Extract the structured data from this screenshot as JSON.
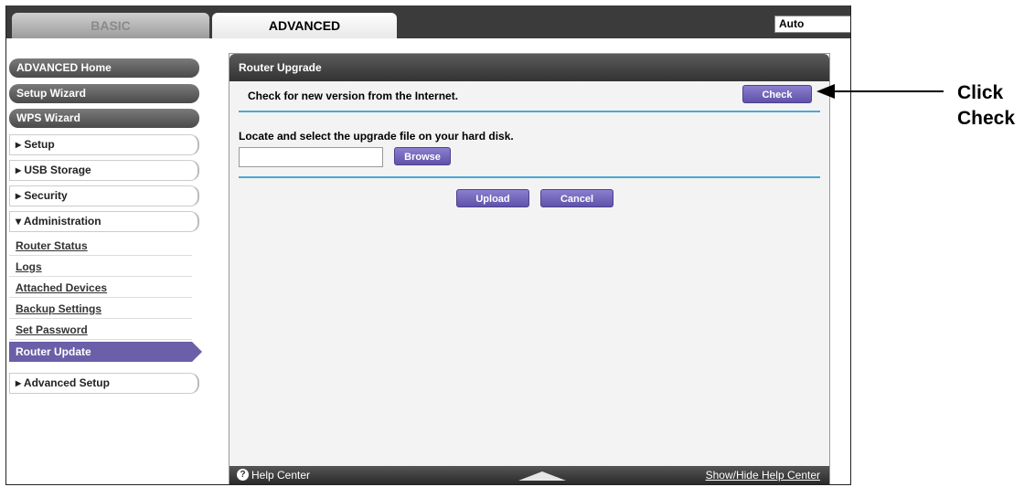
{
  "tabs": {
    "basic": "BASIC",
    "advanced": "ADVANCED"
  },
  "language": {
    "selected": "Auto"
  },
  "sidebar": {
    "top_buttons": [
      "ADVANCED Home",
      "Setup Wizard",
      "WPS Wizard"
    ],
    "sections": [
      {
        "label": "Setup",
        "expanded": false
      },
      {
        "label": "USB Storage",
        "expanded": false
      },
      {
        "label": "Security",
        "expanded": false
      },
      {
        "label": "Administration",
        "expanded": true
      }
    ],
    "admin_items": [
      "Router Status",
      "Logs",
      "Attached Devices",
      "Backup Settings",
      "Set Password",
      "Router Update"
    ],
    "active_item": "Router Update",
    "advanced_setup": "Advanced Setup",
    "arrows": {
      "collapsed": "▸",
      "expanded": "▾"
    }
  },
  "panel": {
    "title": "Router Upgrade",
    "check_text": "Check for new version from the Internet.",
    "check_button": "Check",
    "locate_text": "Locate and select the upgrade file on your hard disk.",
    "browse_button": "Browse",
    "upload_button": "Upload",
    "cancel_button": "Cancel"
  },
  "help": {
    "label": "Help Center",
    "toggle": "Show/Hide Help Center"
  },
  "annotation": {
    "line1": "Click",
    "line2": "Check"
  },
  "colors": {
    "accent": "#6a5fa8",
    "separator": "#4aa9d6"
  }
}
